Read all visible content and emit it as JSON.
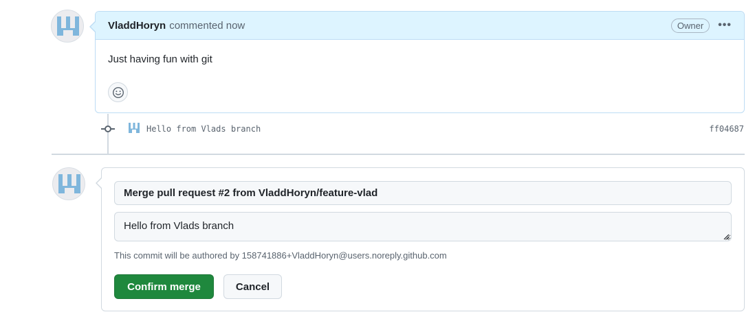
{
  "comment": {
    "author": "VladdHoryn",
    "action_time": "commented now",
    "owner_badge": "Owner",
    "menu_label": "•••",
    "body": "Just having fun with git"
  },
  "commit": {
    "message": "Hello from Vlads branch",
    "sha": "ff04687"
  },
  "merge": {
    "title_value": "Merge pull request #2 from VladdHoryn/feature-vlad",
    "body_value": "Hello from Vlads branch",
    "author_note": "This commit will be authored by 158741886+VladdHoryn@users.noreply.github.com",
    "confirm_label": "Confirm merge",
    "cancel_label": "Cancel"
  },
  "colors": {
    "identicon": "#7fb6dc",
    "confirm_green": "#1f883d",
    "header_blue": "#ddf4ff"
  },
  "icons": [
    "identicon-avatar",
    "smiley-icon",
    "kebab-icon",
    "git-commit-icon",
    "resize-grip-icon"
  ]
}
